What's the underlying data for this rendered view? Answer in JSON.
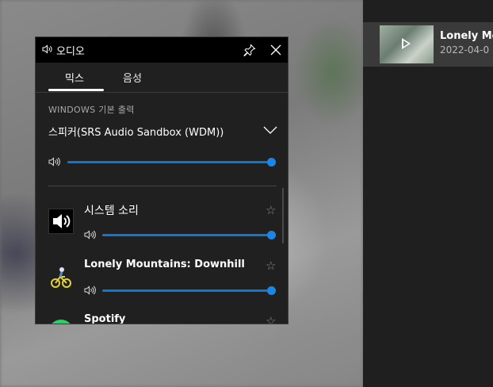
{
  "widget": {
    "title": "오디오",
    "tabs": [
      {
        "label": "믹스",
        "active": true
      },
      {
        "label": "음성",
        "active": false
      }
    ],
    "output": {
      "section_label": "WINDOWS 기본 출력",
      "device": "스피커(SRS Audio Sandbox (WDM))",
      "volume": 1.0
    },
    "apps": [
      {
        "name": "시스템 소리",
        "volume": 1.0,
        "icon": "speaker-icon"
      },
      {
        "name": "Lonely Mountains: Downhill",
        "volume": 1.0,
        "icon": "cyclist-icon"
      },
      {
        "name": "Spotify",
        "volume": 1.0,
        "icon": "spotify-icon"
      }
    ]
  },
  "capture": {
    "title": "Lonely Mou",
    "date": "2022-04-0"
  },
  "colors": {
    "accent": "#0a78d4",
    "panel": "#202020",
    "titlebar": "#000000"
  }
}
